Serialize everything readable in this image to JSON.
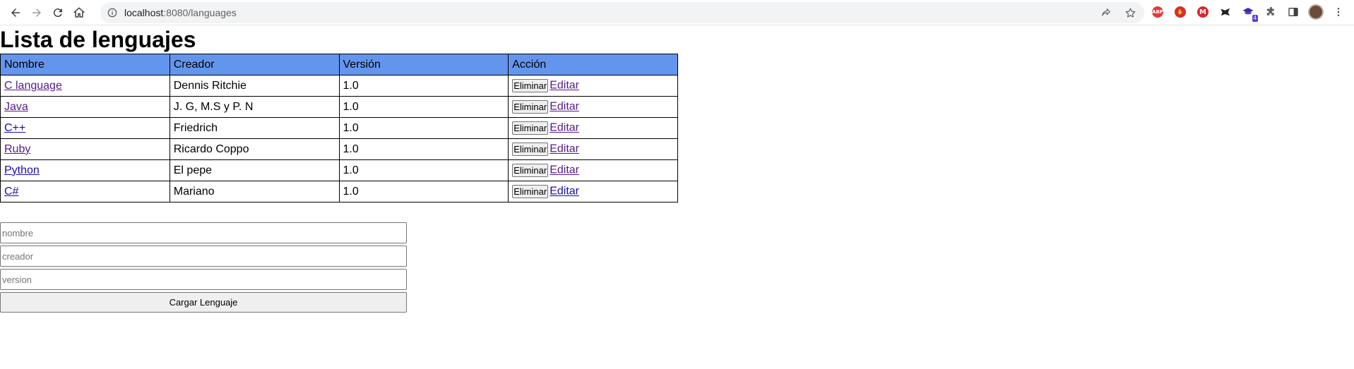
{
  "browser": {
    "url_host": "localhost",
    "url_rest": ":8080/languages"
  },
  "page": {
    "title": "Lista de lenguajes",
    "table": {
      "headers": [
        "Nombre",
        "Creador",
        "Versión",
        "Acción"
      ],
      "rows": [
        {
          "name": "C language",
          "creator": "Dennis Ritchie",
          "version": "1.0",
          "delete": "Eliminar",
          "edit": "Editar"
        },
        {
          "name": "Java",
          "creator": "J. G, M.S y P. N",
          "version": "1.0",
          "delete": "Eliminar",
          "edit": "Editar"
        },
        {
          "name": "C++",
          "creator": "Friedrich",
          "version": "1.0",
          "delete": "Eliminar",
          "edit": "Editar"
        },
        {
          "name": "Ruby",
          "creator": "Ricardo Coppo",
          "version": "1.0",
          "delete": "Eliminar",
          "edit": "Editar"
        },
        {
          "name": "Python",
          "creator": "El pepe",
          "version": "1.0",
          "delete": "Eliminar",
          "edit": "Editar"
        },
        {
          "name": "C#",
          "creator": "Mariano",
          "version": "1.0",
          "delete": "Eliminar",
          "edit": "Editar"
        }
      ]
    },
    "form": {
      "name_placeholder": "nombre",
      "creator_placeholder": "creador",
      "version_placeholder": "version",
      "submit_label": "Cargar Lenguaje"
    }
  },
  "colors": {
    "header_bg": "#6495ed",
    "link": "#1a0dab",
    "visited_link": "#551a8b"
  },
  "extensions": {
    "abp_label": "ABP",
    "badge_count": "4"
  }
}
